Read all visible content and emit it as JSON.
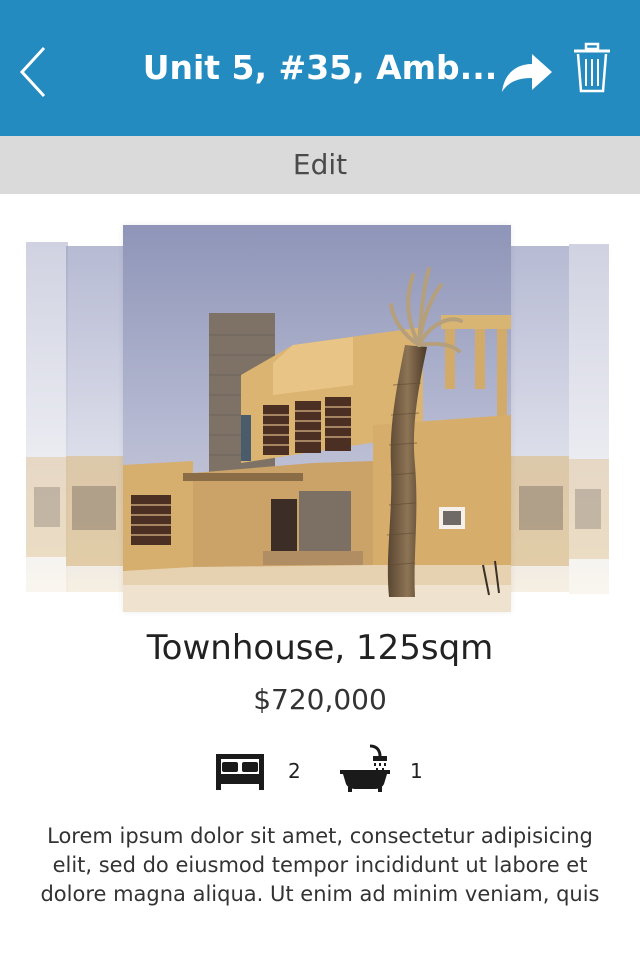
{
  "navbar": {
    "title": "Unit 5, #35, Amb...",
    "back_icon": "chevron-left-icon",
    "share_icon": "share-arrow-icon",
    "delete_icon": "trash-icon",
    "background_color": "#238bbf"
  },
  "editbar": {
    "label": "Edit",
    "background_color": "#dadada"
  },
  "listing": {
    "title": "Townhouse, 125sqm",
    "price": "$720,000",
    "bedrooms": "2",
    "bathrooms": "1",
    "bed_icon": "bed-icon",
    "bath_icon": "bathtub-icon",
    "description": "Lorem ipsum dolor sit amet, consectetur adipisicing elit, sed do eiusmod tempor incididunt ut labore et dolore magna aliqua. Ut enim ad minim veniam, quis"
  }
}
